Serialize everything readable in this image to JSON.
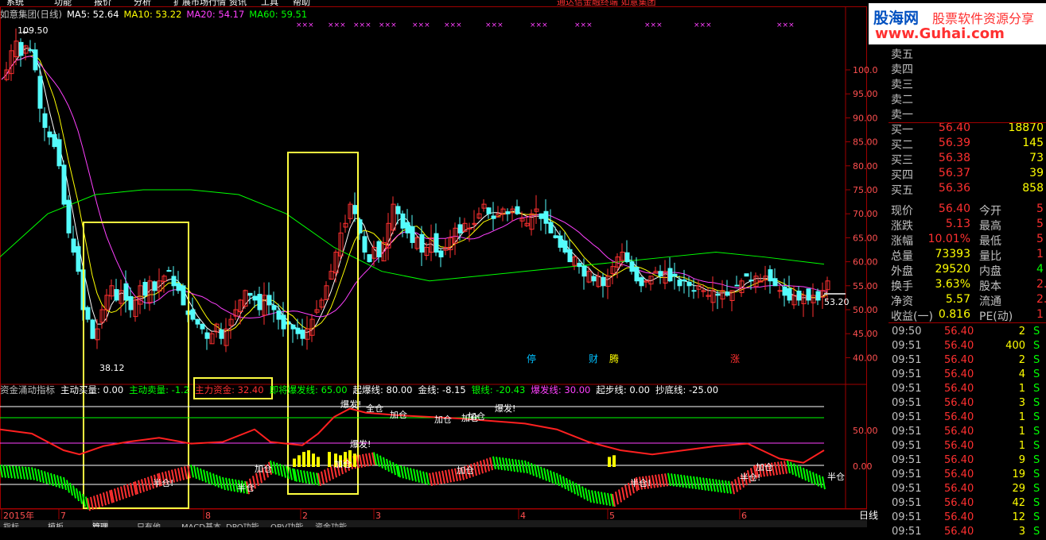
{
  "menubar": [
    "系统",
    "功能",
    "报价",
    "分析",
    "扩展市场行情",
    "资讯",
    "工具",
    "帮助"
  ],
  "menubar_center": "通达信金融终端 如意集团",
  "header": {
    "stock": "如意集团(日线)",
    "ma5": "MA5: 52.64",
    "ma10": "MA10: 53.22",
    "ma20": "MA20: 54.17",
    "ma60": "MA60: 59.51"
  },
  "price_axis": [
    "100.0",
    "95.00",
    "90.00",
    "85.00",
    "80.00",
    "75.00",
    "70.00",
    "65.00",
    "60.00",
    "55.00",
    "50.00",
    "45.00",
    "40.00"
  ],
  "annotations": {
    "high": "109.50",
    "low": "38.12",
    "last": "53.20",
    "markers": [
      "停",
      "财",
      "腾",
      "涨"
    ]
  },
  "indicator": {
    "title": "资金涌动指标",
    "params": [
      {
        "text": "主动买量: 0.00",
        "color": "#ffffff"
      },
      {
        "text": "主动卖量: -1.2",
        "color": "#00ff00"
      },
      {
        "text": "主力资金: 32.40",
        "color": "#ff3030"
      },
      {
        "text": "即将爆发线: 65.00",
        "color": "#00ff00"
      },
      {
        "text": "起爆线: 80.00",
        "color": "#ffffff"
      },
      {
        "text": "金线: -8.15",
        "color": "#ffffff"
      },
      {
        "text": "银线: -20.43",
        "color": "#00ff00"
      },
      {
        "text": "爆发线: 30.00",
        "color": "#ff40ff"
      },
      {
        "text": "起步线: 0.00",
        "color": "#ffffff"
      },
      {
        "text": "抄底线: -25.00",
        "color": "#ffffff"
      }
    ],
    "axis": [
      "50.00",
      "0.00"
    ],
    "labels": [
      "爆发!",
      "全仓",
      "加仓",
      "加仓",
      "加仓",
      "加仓",
      "爆发!",
      "爆发!",
      "加仓",
      "半仓!",
      "半仓",
      "加仓",
      "加仓",
      "半仓!",
      "半仓!",
      "加仓",
      "半仓"
    ]
  },
  "date_axis": [
    "2015年",
    "7",
    "8",
    "2",
    "3",
    "4",
    "5",
    "6"
  ],
  "period_label": "日线",
  "bottom_tabs": [
    "指标",
    "模板",
    "管理",
    "只有他",
    "MACD基本",
    "DPO功能",
    "OBV功能",
    "资金功能"
  ],
  "watermark": {
    "brand": "股海网",
    "slogan": "股票软件资源分享",
    "url": "www.Guhai.com"
  },
  "order_book": [
    {
      "label": "卖五",
      "price": "",
      "vol": ""
    },
    {
      "label": "卖四",
      "price": "",
      "vol": ""
    },
    {
      "label": "卖三",
      "price": "",
      "vol": ""
    },
    {
      "label": "卖二",
      "price": "",
      "vol": ""
    },
    {
      "label": "卖一",
      "price": "",
      "vol": ""
    },
    {
      "label": "买一",
      "price": "56.40",
      "vol": "18870"
    },
    {
      "label": "买二",
      "price": "56.39",
      "vol": "145"
    },
    {
      "label": "买三",
      "price": "56.38",
      "vol": "73"
    },
    {
      "label": "买四",
      "price": "56.37",
      "vol": "39"
    },
    {
      "label": "买五",
      "price": "56.36",
      "vol": "858"
    }
  ],
  "quote": [
    {
      "l1": "现价",
      "v1": "56.40",
      "l2": "今开",
      "v2": "5"
    },
    {
      "l1": "涨跌",
      "v1": "5.13",
      "l2": "最高",
      "v2": "5"
    },
    {
      "l1": "涨幅",
      "v1": "10.01%",
      "l2": "最低",
      "v2": "5"
    },
    {
      "l1": "总量",
      "v1": "73393",
      "l2": "量比",
      "v2": "1"
    },
    {
      "l1": "外盘",
      "v1": "29520",
      "l2": "内盘",
      "v2": "4"
    },
    {
      "l1": "换手",
      "v1": "3.63%",
      "l2": "股本",
      "v2": "2."
    },
    {
      "l1": "净资",
      "v1": "5.57",
      "l2": "流通",
      "v2": "2."
    },
    {
      "l1": "收益(一)",
      "v1": "0.816",
      "l2": "PE(动)",
      "v2": "1"
    }
  ],
  "ticks": [
    {
      "time": "09:50",
      "price": "56.40",
      "vol": "2",
      "side": "S"
    },
    {
      "time": "09:51",
      "price": "56.40",
      "vol": "400",
      "side": "S"
    },
    {
      "time": "09:51",
      "price": "56.40",
      "vol": "2",
      "side": "S"
    },
    {
      "time": "09:51",
      "price": "56.40",
      "vol": "4",
      "side": "S"
    },
    {
      "time": "09:51",
      "price": "56.40",
      "vol": "1",
      "side": "S"
    },
    {
      "time": "09:51",
      "price": "56.40",
      "vol": "3",
      "side": "S"
    },
    {
      "time": "09:51",
      "price": "56.40",
      "vol": "1",
      "side": "S"
    },
    {
      "time": "09:51",
      "price": "56.40",
      "vol": "1",
      "side": "S"
    },
    {
      "time": "09:51",
      "price": "56.40",
      "vol": "1",
      "side": "S"
    },
    {
      "time": "09:51",
      "price": "56.40",
      "vol": "9",
      "side": "S"
    },
    {
      "time": "09:51",
      "price": "56.40",
      "vol": "19",
      "side": "S"
    },
    {
      "time": "09:51",
      "price": "56.40",
      "vol": "29",
      "side": "S"
    },
    {
      "time": "09:51",
      "price": "56.40",
      "vol": "42",
      "side": "S"
    },
    {
      "time": "09:51",
      "price": "56.40",
      "vol": "12",
      "side": "S"
    },
    {
      "time": "09:51",
      "price": "56.40",
      "vol": "3",
      "side": "S"
    }
  ],
  "colors": {
    "up": "#ff3030",
    "down": "#54fcfc",
    "ma5": "#ffffff",
    "ma10": "#ffff00",
    "ma20": "#ff40ff",
    "ma60": "#00ff00",
    "box": "#ffff40"
  }
}
